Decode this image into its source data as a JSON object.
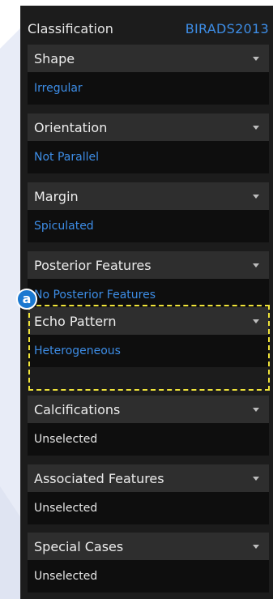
{
  "panel": {
    "title": "Classification",
    "scheme": "BIRADS2013"
  },
  "groups": [
    {
      "label": "Shape",
      "value": "Irregular",
      "selected": true
    },
    {
      "label": "Orientation",
      "value": "Not Parallel",
      "selected": true
    },
    {
      "label": "Margin",
      "value": "Spiculated",
      "selected": true
    },
    {
      "label": "Posterior Features",
      "value": "No Posterior Features",
      "selected": true
    },
    {
      "label": "Echo Pattern",
      "value": "Heterogeneous",
      "selected": true
    },
    {
      "label": "Calcifications",
      "value": "Unselected",
      "selected": false
    },
    {
      "label": "Associated Features",
      "value": "Unselected",
      "selected": false
    },
    {
      "label": "Special Cases",
      "value": "Unselected",
      "selected": false
    }
  ],
  "callout": {
    "marker": "a"
  },
  "colors": {
    "accent": "#3d8de6",
    "highlight": "#f0e43a",
    "marker": "#1a78d0"
  }
}
